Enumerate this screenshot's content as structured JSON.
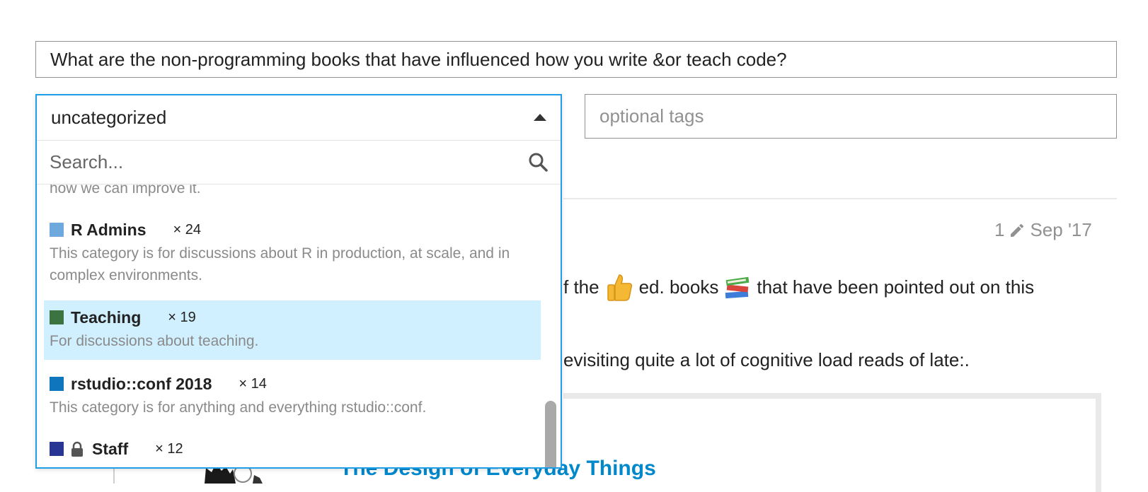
{
  "composer": {
    "title_value": "What are the non-programming books that have influenced how you write &or teach code?",
    "tags_placeholder": "optional tags"
  },
  "category_dropdown": {
    "selected": "uncategorized",
    "search_placeholder": "Search...",
    "clipped_description": "how we can improve it.",
    "items": [
      {
        "name": "R Admins",
        "count": "× 24",
        "description": "This category is for discussions about R in production, at scale, and in complex environments.",
        "color": "#6fa8dc",
        "locked": false
      },
      {
        "name": "Teaching",
        "count": "× 19",
        "description": "For discussions about teaching.",
        "color": "#3d7341",
        "locked": false
      },
      {
        "name": "rstudio::conf 2018",
        "count": "× 14",
        "description": "This category is for anything and everything rstudio::conf.",
        "color": "#0e76bd",
        "locked": false
      },
      {
        "name": "Staff",
        "count": "× 12",
        "description": "",
        "color": "#283593",
        "locked": true
      }
    ],
    "highlight_index": 1
  },
  "post_preview": {
    "edits": "1",
    "date": "Sep '17",
    "line1_a": "f the",
    "line1_b": "ed. books",
    "line1_c": "that have been pointed out on this",
    "line2": "evisiting quite a lot of cognitive load reads of late:.",
    "onebox_title": "The Design of Everyday Things"
  },
  "colors": {
    "accent": "#1e9ee6",
    "highlight": "#d1f0ff",
    "link": "#0088cc"
  }
}
